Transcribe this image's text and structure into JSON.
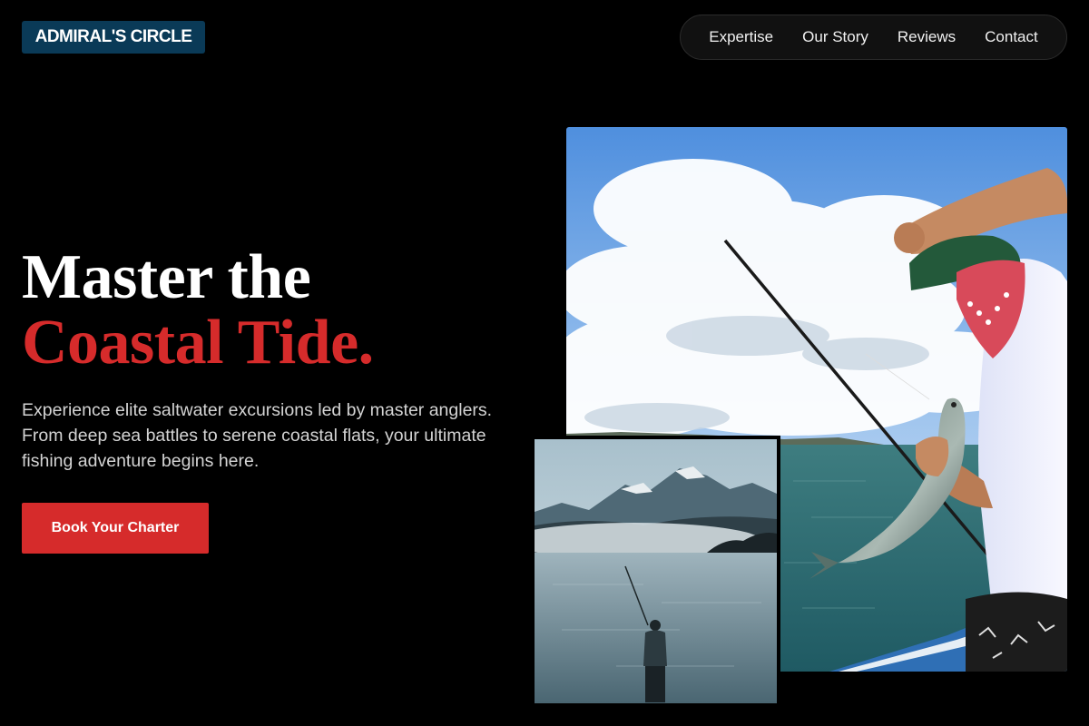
{
  "brand": {
    "name": "ADMIRAL'S CIRCLE"
  },
  "nav": {
    "items": [
      {
        "label": "Expertise"
      },
      {
        "label": "Our Story"
      },
      {
        "label": "Reviews"
      },
      {
        "label": "Contact"
      }
    ]
  },
  "hero": {
    "headline_line1": "Master the",
    "headline_line2": "Coastal Tide.",
    "description": "Experience elite saltwater excursions led by master anglers. From deep sea battles to serene coastal flats, your ultimate fishing adventure begins here.",
    "cta_label": "Book Your Charter"
  },
  "colors": {
    "background": "#000000",
    "accent_red": "#d62b2b",
    "logo_bg": "#0a3a57",
    "nav_bg": "#111111"
  },
  "images": {
    "main": "angler-holding-fish-on-boat-photo",
    "inset": "fly-fisherman-in-misty-mountain-lake-photo"
  }
}
